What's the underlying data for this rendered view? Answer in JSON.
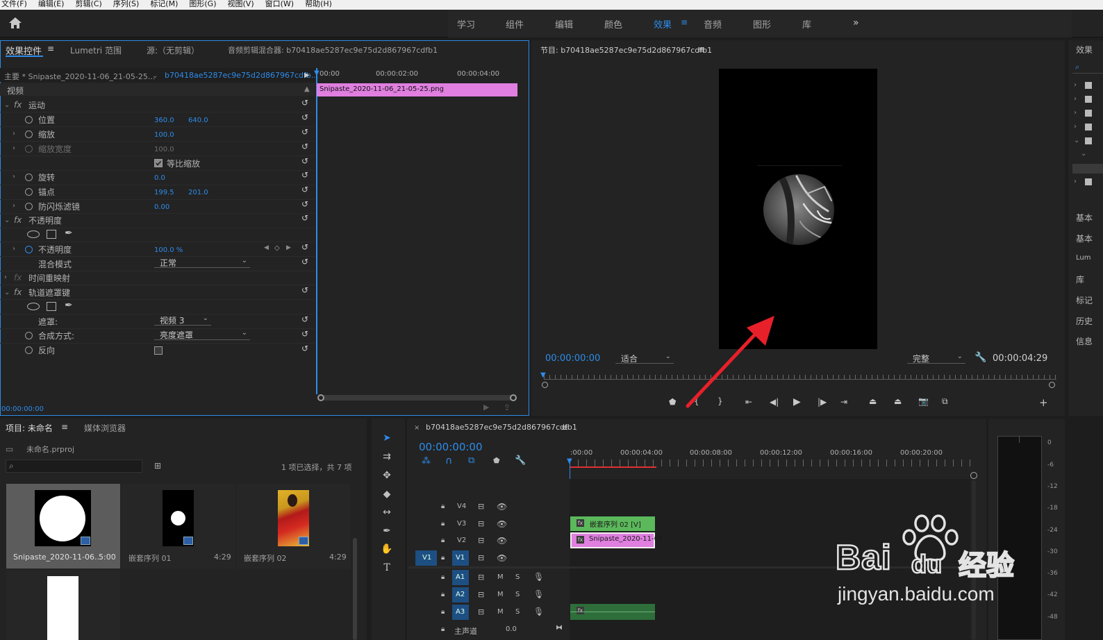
{
  "menu": [
    "文件(F)",
    "编辑(E)",
    "剪辑(C)",
    "序列(S)",
    "标记(M)",
    "图形(G)",
    "视图(V)",
    "窗口(W)",
    "帮助(H)"
  ],
  "workspaces": [
    "学习",
    "组件",
    "编辑",
    "颜色",
    "效果",
    "音频",
    "图形",
    "库"
  ],
  "active_workspace": "效果",
  "effects_panel": {
    "tabs": [
      "效果控件",
      "Lumetri 范围",
      "源:（无剪辑）",
      "音频剪辑混合器: b70418ae5287ec9e75d2d867967cdfb1"
    ],
    "master_clip": "主要 * Snipaste_2020-11-06_21-05-25...",
    "sequence_clip": "b70418ae5287ec9e75d2d867967cdfb...",
    "section_video": "视频",
    "ruler": [
      "00:00",
      "00:00:02:00",
      "00:00:04:00"
    ],
    "clip_bar": "Snipaste_2020-11-06_21-05-25.png",
    "rows": {
      "motion": "运动",
      "position": "位置",
      "position_x": "360.0",
      "position_y": "640.0",
      "scale": "缩放",
      "scale_val": "100.0",
      "scale_width": "缩放宽度",
      "scale_width_val": "100.0",
      "uniform_scale": "等比缩放",
      "rotation": "旋转",
      "rotation_val": "0.0",
      "anchor": "锚点",
      "anchor_x": "199.5",
      "anchor_y": "201.0",
      "flicker": "防闪烁滤镜",
      "flicker_val": "0.00",
      "opacity_group": "不透明度",
      "opacity": "不透明度",
      "opacity_val": "100.0 %",
      "blend_mode": "混合模式",
      "blend_mode_val": "正常",
      "time_remap": "时间重映射",
      "track_matte": "轨道遮罩键",
      "matte": "遮罩:",
      "matte_val": "视频 3",
      "composite": "合成方式:",
      "composite_val": "亮度遮罩",
      "reverse": "反向"
    },
    "timecode": "00:00:00:00"
  },
  "program_monitor": {
    "title": "节目: b70418ae5287ec9e75d2d867967cdfb1",
    "timecode": "00:00:00:00",
    "fit": "适合",
    "quality": "完整",
    "duration": "00:00:04:29"
  },
  "project_panel": {
    "tabs": [
      "项目: 未命名",
      "媒体浏览器"
    ],
    "file": "未命名.prproj",
    "selection_info": "1 项已选择，共 7 项",
    "items": [
      {
        "name": "Snipaste_2020-11-06...",
        "duration": "5:00"
      },
      {
        "name": "嵌套序列 01",
        "duration": "4:29"
      },
      {
        "name": "嵌套序列 02",
        "duration": "4:29"
      }
    ]
  },
  "timeline": {
    "title": "b70418ae5287ec9e75d2d867967cdfb1",
    "timecode": "00:00:00:00",
    "ruler": [
      ":00:00",
      "00:00:04:00",
      "00:00:08:00",
      "00:00:12:00",
      "00:00:16:00",
      "00:00:20:00"
    ],
    "tracks": [
      "V4",
      "V3",
      "V2",
      "V1",
      "A1",
      "A2",
      "A3"
    ],
    "source_v": "V1",
    "clip_v3": "嵌套序列 02 [V]",
    "clip_v2": "Snipaste_2020-11-06",
    "master": "主声道",
    "master_val": "0.0",
    "m_label": "M",
    "s_label": "S"
  },
  "meter": [
    "0",
    "-6",
    "-12",
    "-18",
    "-24",
    "-30",
    "-36",
    "-42",
    "-48"
  ],
  "right_panel": [
    "效果",
    "基本",
    "基本",
    "Lum",
    "库",
    "标记",
    "历史",
    "信息"
  ],
  "watermark": {
    "brand": "Bai",
    "brand2": "du",
    "cn": "经验",
    "url": "jingyan.baidu.com"
  },
  "colors": {
    "accent": "#2d8ceb",
    "clip_pink": "#e07fe0",
    "clip_green": "#5bb85b",
    "audio_green": "#2e6e3a",
    "arrow_red": "#e8202a"
  }
}
